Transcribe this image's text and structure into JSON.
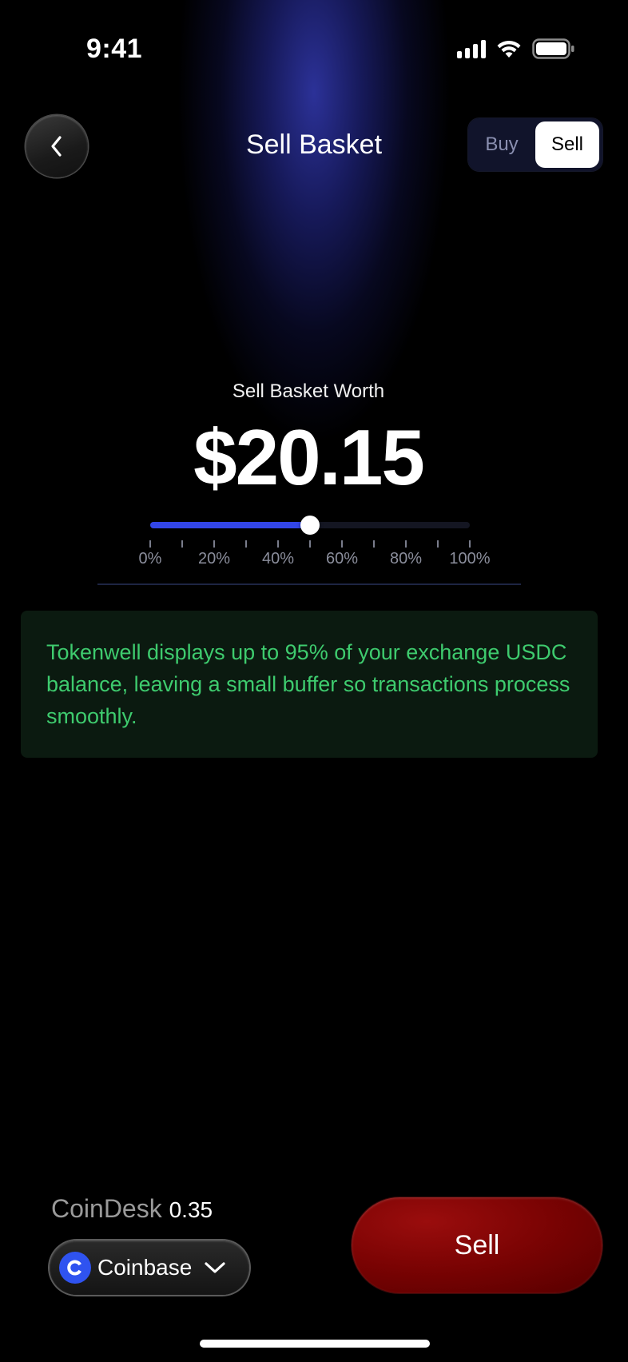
{
  "status_bar": {
    "time": "9:41",
    "icons": [
      "cellular-signal-icon",
      "wifi-icon",
      "battery-icon"
    ]
  },
  "header": {
    "back_icon": "chevron-left-icon",
    "title": "Sell Basket",
    "toggle": {
      "options": [
        "Buy",
        "Sell"
      ],
      "selected": "Sell"
    }
  },
  "worth": {
    "label": "Sell Basket Worth",
    "value": "$20.15"
  },
  "slider": {
    "value_percent": 50,
    "tick_labels": [
      "0%",
      "20%",
      "40%",
      "60%",
      "80%",
      "100%"
    ],
    "accent_color": "#3346e8"
  },
  "info": {
    "text": "Tokenwell displays up to 95% of your exchange USDC balance, leaving a small buffer so transactions process smoothly.",
    "text_color": "#3ecb6e"
  },
  "footer": {
    "provider_name": "CoinDesk",
    "provider_value": "0.35",
    "exchange": {
      "icon": "coinbase-icon",
      "label": "Coinbase",
      "chevron": "chevron-down-icon"
    },
    "sell_button_label": "Sell",
    "sell_button_color": "#7a0303"
  }
}
